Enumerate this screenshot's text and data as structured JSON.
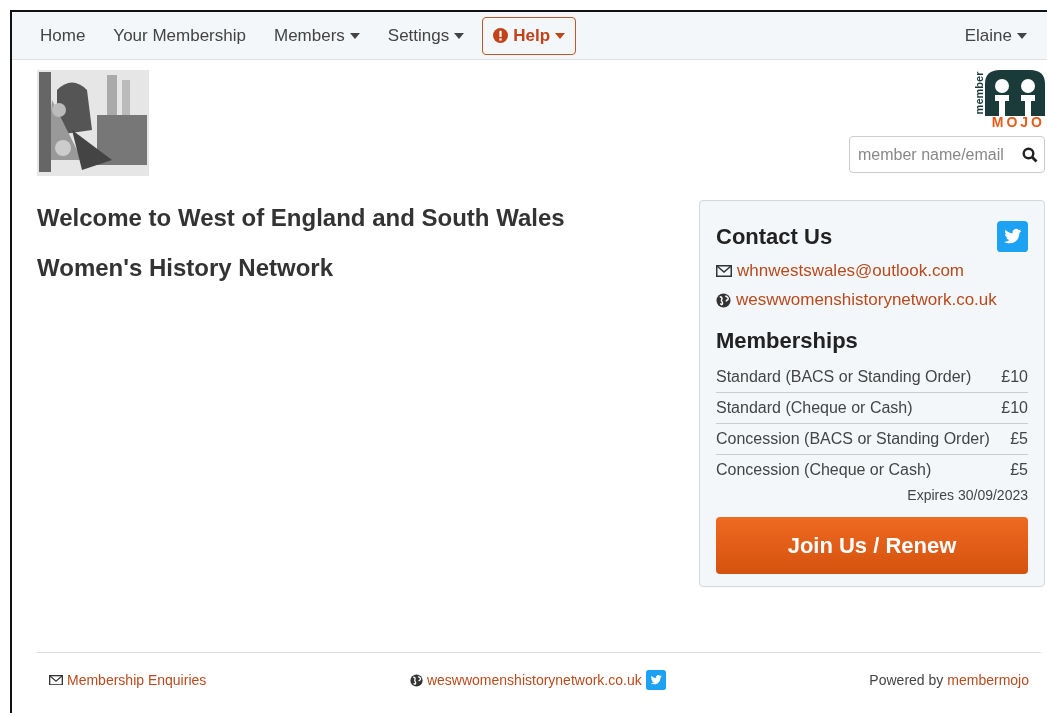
{
  "nav": {
    "items": [
      {
        "label": "Home",
        "dropdown": false,
        "kind": "plain"
      },
      {
        "label": "Your Membership",
        "dropdown": false,
        "kind": "plain"
      },
      {
        "label": "Members",
        "dropdown": true,
        "kind": "plain"
      },
      {
        "label": "Settings",
        "dropdown": true,
        "kind": "plain"
      },
      {
        "label": "Help",
        "dropdown": true,
        "kind": "help"
      }
    ],
    "user": {
      "label": "Elaine",
      "dropdown": true
    }
  },
  "header": {
    "logo": {
      "top": "member",
      "bottom": "MOJO"
    },
    "search": {
      "placeholder": "member name/email"
    }
  },
  "welcome": {
    "lines": [
      "Welcome to West of England and South Wales",
      "Women's History Network"
    ]
  },
  "contact": {
    "title": "Contact Us",
    "email": "whnwestswales@outlook.com",
    "website": "weswwomenshistorynetwork.co.uk"
  },
  "memberships": {
    "title": "Memberships",
    "rows": [
      {
        "name": "Standard (BACS or Standing Order)",
        "price": "£10"
      },
      {
        "name": "Standard (Cheque or Cash)",
        "price": "£10"
      },
      {
        "name": "Concession (BACS or Standing Order)",
        "price": "£5"
      },
      {
        "name": "Concession (Cheque or Cash)",
        "price": "£5"
      }
    ],
    "expires": "Expires 30/09/2023",
    "button": "Join Us / Renew"
  },
  "footer": {
    "enquiries": "Membership Enquiries",
    "website": "weswwomenshistorynetwork.co.uk",
    "powered_by": "Powered by",
    "powered_link": "membermojo"
  }
}
